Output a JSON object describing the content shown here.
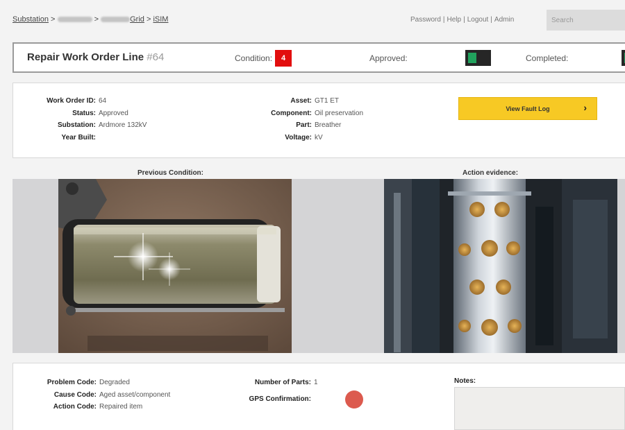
{
  "breadcrumb": {
    "root": "Substation",
    "sep": ">",
    "grid": "Grid",
    "current": "iSIM"
  },
  "topnav": {
    "links": [
      "Password",
      "Help",
      "Logout",
      "Admin"
    ],
    "sep": "|"
  },
  "search": {
    "placeholder": "Search"
  },
  "header": {
    "title": "Repair Work Order Line",
    "number": "#64",
    "condition_label": "Condition:",
    "condition_value": "4",
    "approved_label": "Approved:",
    "completed_label": "Completed:"
  },
  "info": {
    "left": [
      {
        "key": "Work Order ID:",
        "value": "64"
      },
      {
        "key": "Status:",
        "value": "Approved"
      },
      {
        "key": "Substation:",
        "value": "Ardmore 132kV"
      },
      {
        "key": "Year Built:",
        "value": ""
      }
    ],
    "middle": [
      {
        "key": "Asset:",
        "value": "GT1 ET"
      },
      {
        "key": "Component:",
        "value": "Oil preservation"
      },
      {
        "key": "Part:",
        "value": "Breather"
      },
      {
        "key": "Voltage:",
        "value": "kV"
      }
    ],
    "fault_button": "View Fault Log"
  },
  "images": {
    "previous_title": "Previous Condition:",
    "evidence_title": "Action evidence:"
  },
  "bottom": {
    "left": [
      {
        "key": "Problem Code:",
        "value": "Degraded"
      },
      {
        "key": "Cause Code:",
        "value": "Aged asset/component"
      },
      {
        "key": "Action Code:",
        "value": "Repaired item"
      }
    ],
    "parts_label": "Number of Parts:",
    "parts_value": "1",
    "gps_label": "GPS Confirmation:",
    "notes_label": "Notes:"
  },
  "colors": {
    "condition_badge": "#e20e0e",
    "toggle_on": "#21a35d",
    "fault_button": "#f7c924",
    "gps_indicator": "#dc5a4e"
  }
}
